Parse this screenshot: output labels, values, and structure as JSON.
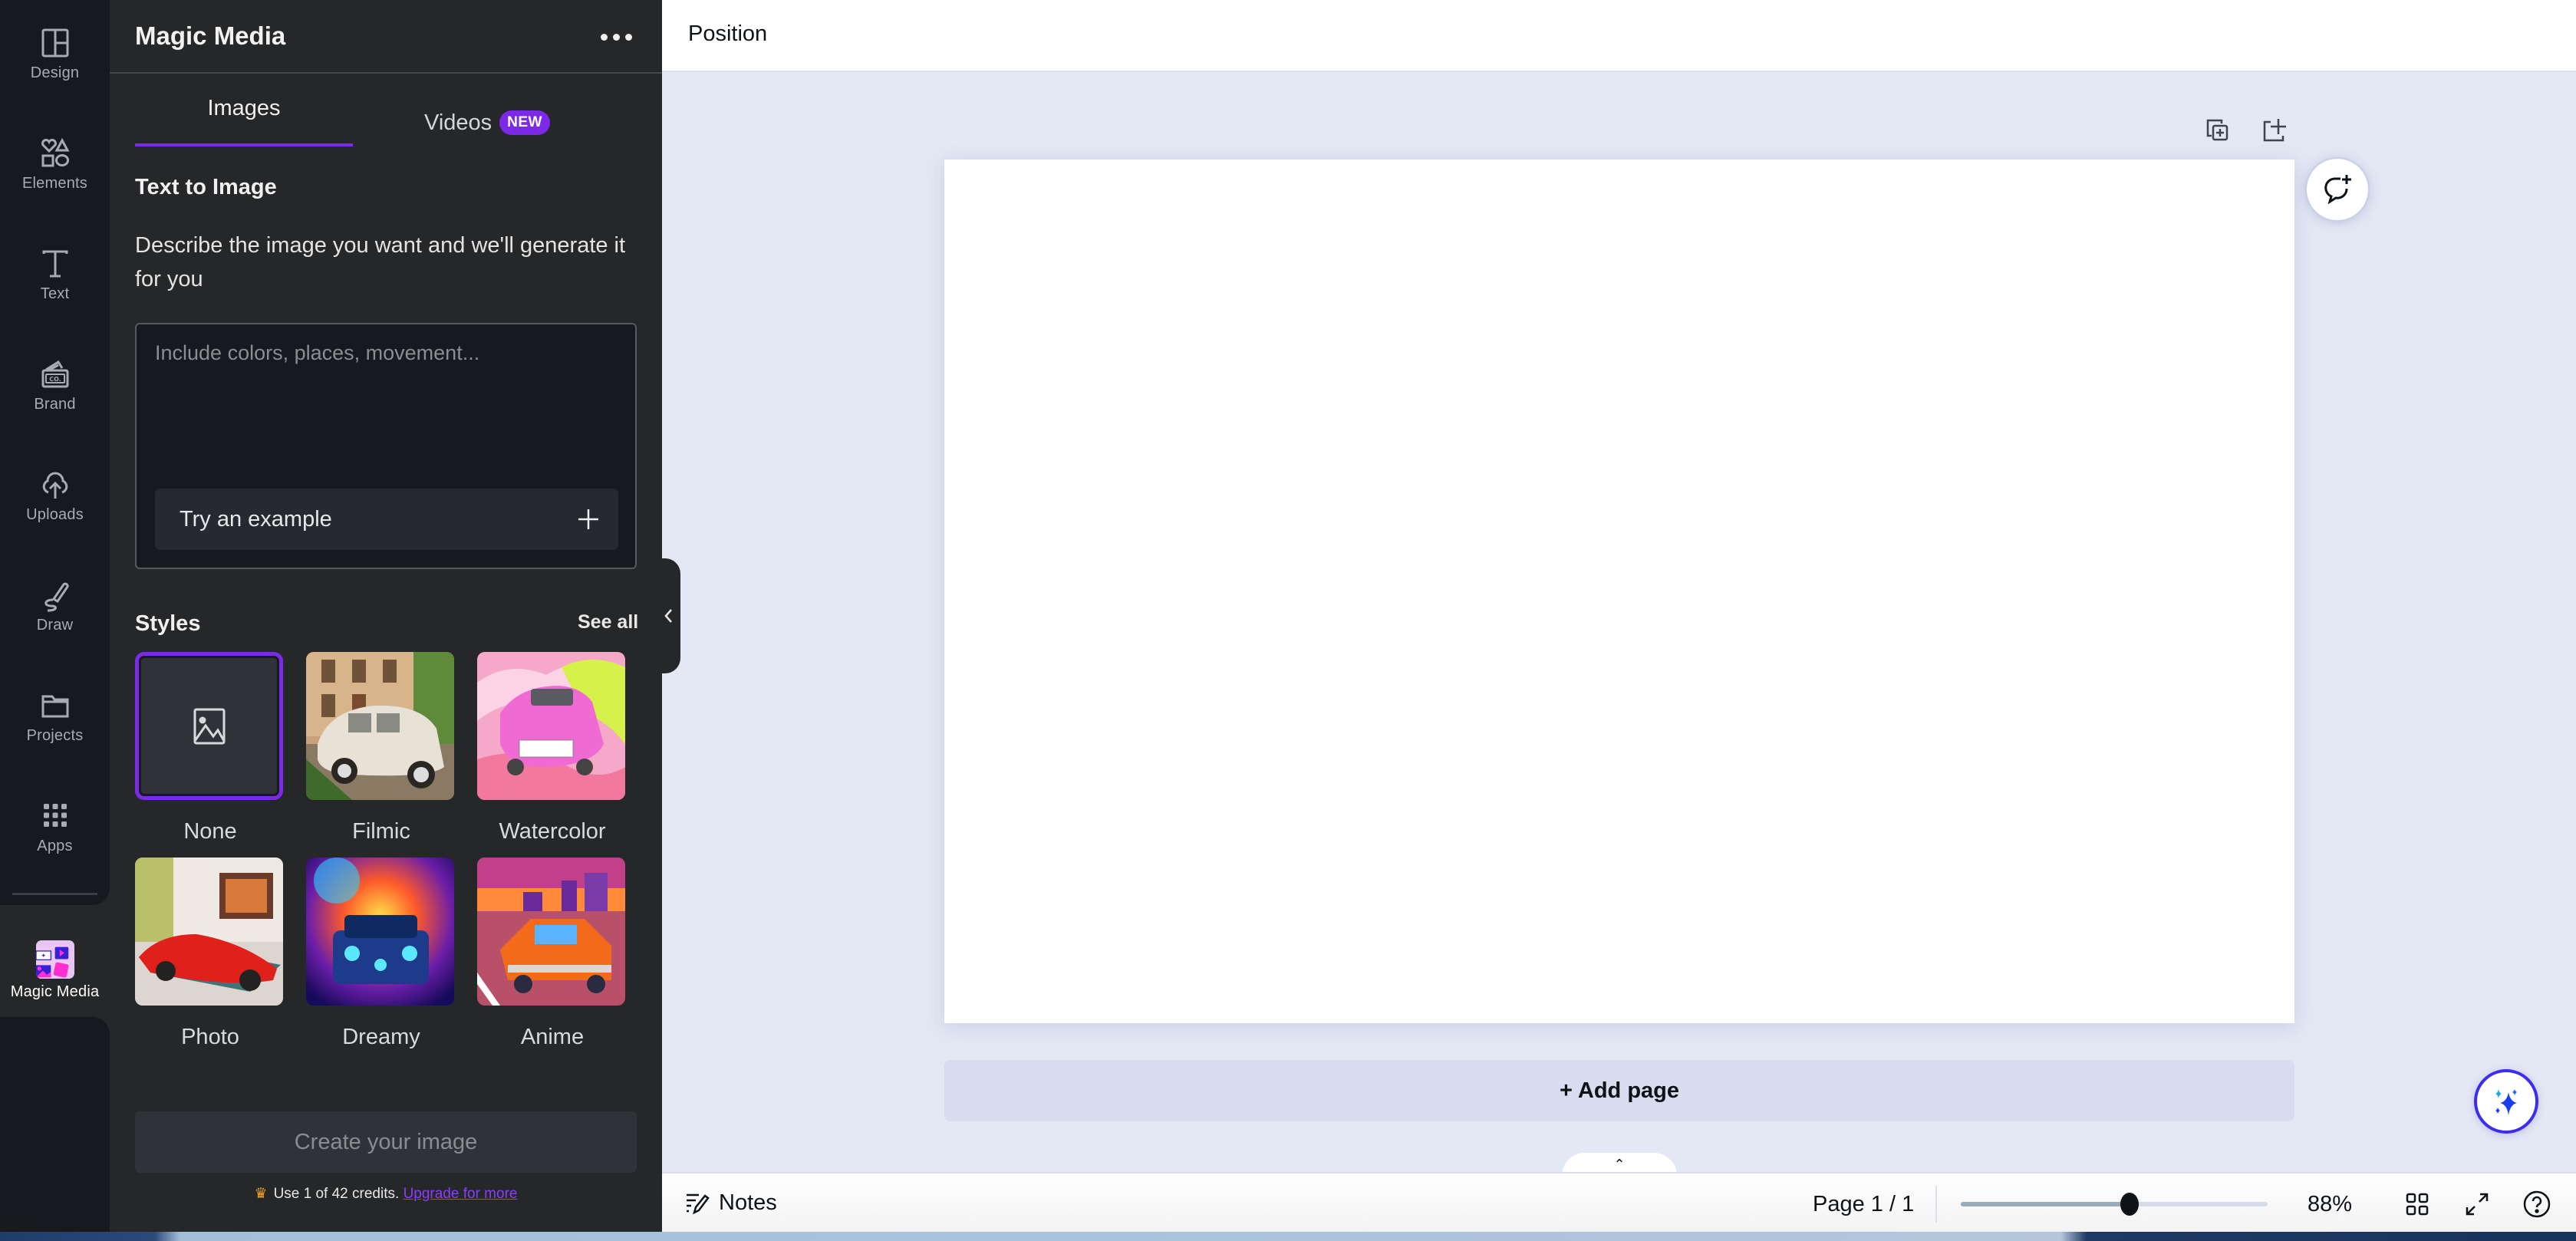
{
  "rail": {
    "items": [
      {
        "label": "Design",
        "icon": "design-icon"
      },
      {
        "label": "Elements",
        "icon": "elements-icon"
      },
      {
        "label": "Text",
        "icon": "text-icon"
      },
      {
        "label": "Brand",
        "icon": "brand-icon"
      },
      {
        "label": "Uploads",
        "icon": "uploads-icon"
      },
      {
        "label": "Draw",
        "icon": "draw-icon"
      },
      {
        "label": "Projects",
        "icon": "projects-icon"
      },
      {
        "label": "Apps",
        "icon": "apps-icon"
      },
      {
        "label": "Magic Media",
        "icon": "magic-media-icon",
        "active": true
      }
    ],
    "brand_icon_text": "CO."
  },
  "panel": {
    "title": "Magic Media",
    "tabs": [
      {
        "label": "Images",
        "active": true
      },
      {
        "label": "Videos",
        "badge": "NEW"
      }
    ],
    "section_title": "Text to Image",
    "description": "Describe the image you want and we'll generate it for you",
    "prompt": {
      "value": "",
      "placeholder": "Include colors, places, movement..."
    },
    "try_example_label": "Try an example",
    "styles_title": "Styles",
    "see_all_label": "See all",
    "styles": [
      {
        "label": "None",
        "selected": true
      },
      {
        "label": "Filmic"
      },
      {
        "label": "Watercolor"
      },
      {
        "label": "Photo"
      },
      {
        "label": "Dreamy"
      },
      {
        "label": "Anime"
      }
    ],
    "create_button_label": "Create your image",
    "credits_text": "Use 1 of 42 credits.",
    "upgrade_link": "Upgrade for more"
  },
  "topbar": {
    "position_label": "Position"
  },
  "canvas": {
    "add_page_label": "+ Add page"
  },
  "bottombar": {
    "notes_label": "Notes",
    "page_indicator": "Page 1 / 1",
    "zoom_level": "88%",
    "zoom_fraction": 0.55
  },
  "colors": {
    "accent": "#7d2ae8",
    "rail_bg": "#17191e",
    "panel_bg": "#252729",
    "canvas_bg": "#e4e7f4",
    "link": "#8b3dff"
  }
}
